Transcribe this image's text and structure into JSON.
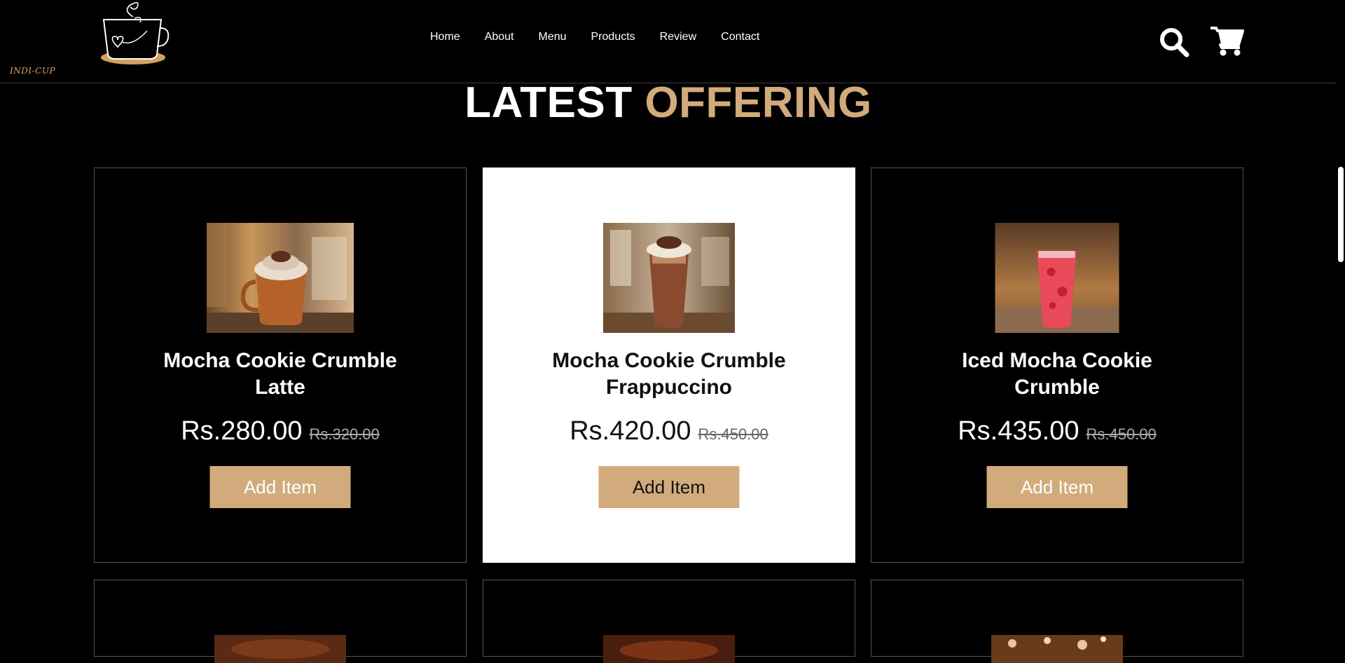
{
  "brand": {
    "logo_text": "INDI-CUP",
    "accent_color": "#d2ab7c"
  },
  "nav": {
    "items": [
      "Home",
      "About",
      "Menu",
      "Products",
      "Review",
      "Contact"
    ]
  },
  "header_icons": {
    "search": "search-icon",
    "cart": "cart-icon"
  },
  "section": {
    "title_main": "LATEST",
    "title_accent": "OFFERING"
  },
  "products": [
    {
      "name": "Mocha Cookie Crumble Latte",
      "price": "Rs.280.00",
      "old_price": "Rs.320.00",
      "button": "Add Item",
      "image": "hot-mocha-mug-image"
    },
    {
      "name": "Mocha Cookie Crumble Frappuccino",
      "price": "Rs.420.00",
      "old_price": "Rs.450.00",
      "button": "Add Item",
      "image": "frappuccino-glass-image"
    },
    {
      "name": "Iced Mocha Cookie Crumble",
      "price": "Rs.435.00",
      "old_price": "Rs.450.00",
      "button": "Add Item",
      "image": "iced-strawberry-drink-image"
    }
  ]
}
